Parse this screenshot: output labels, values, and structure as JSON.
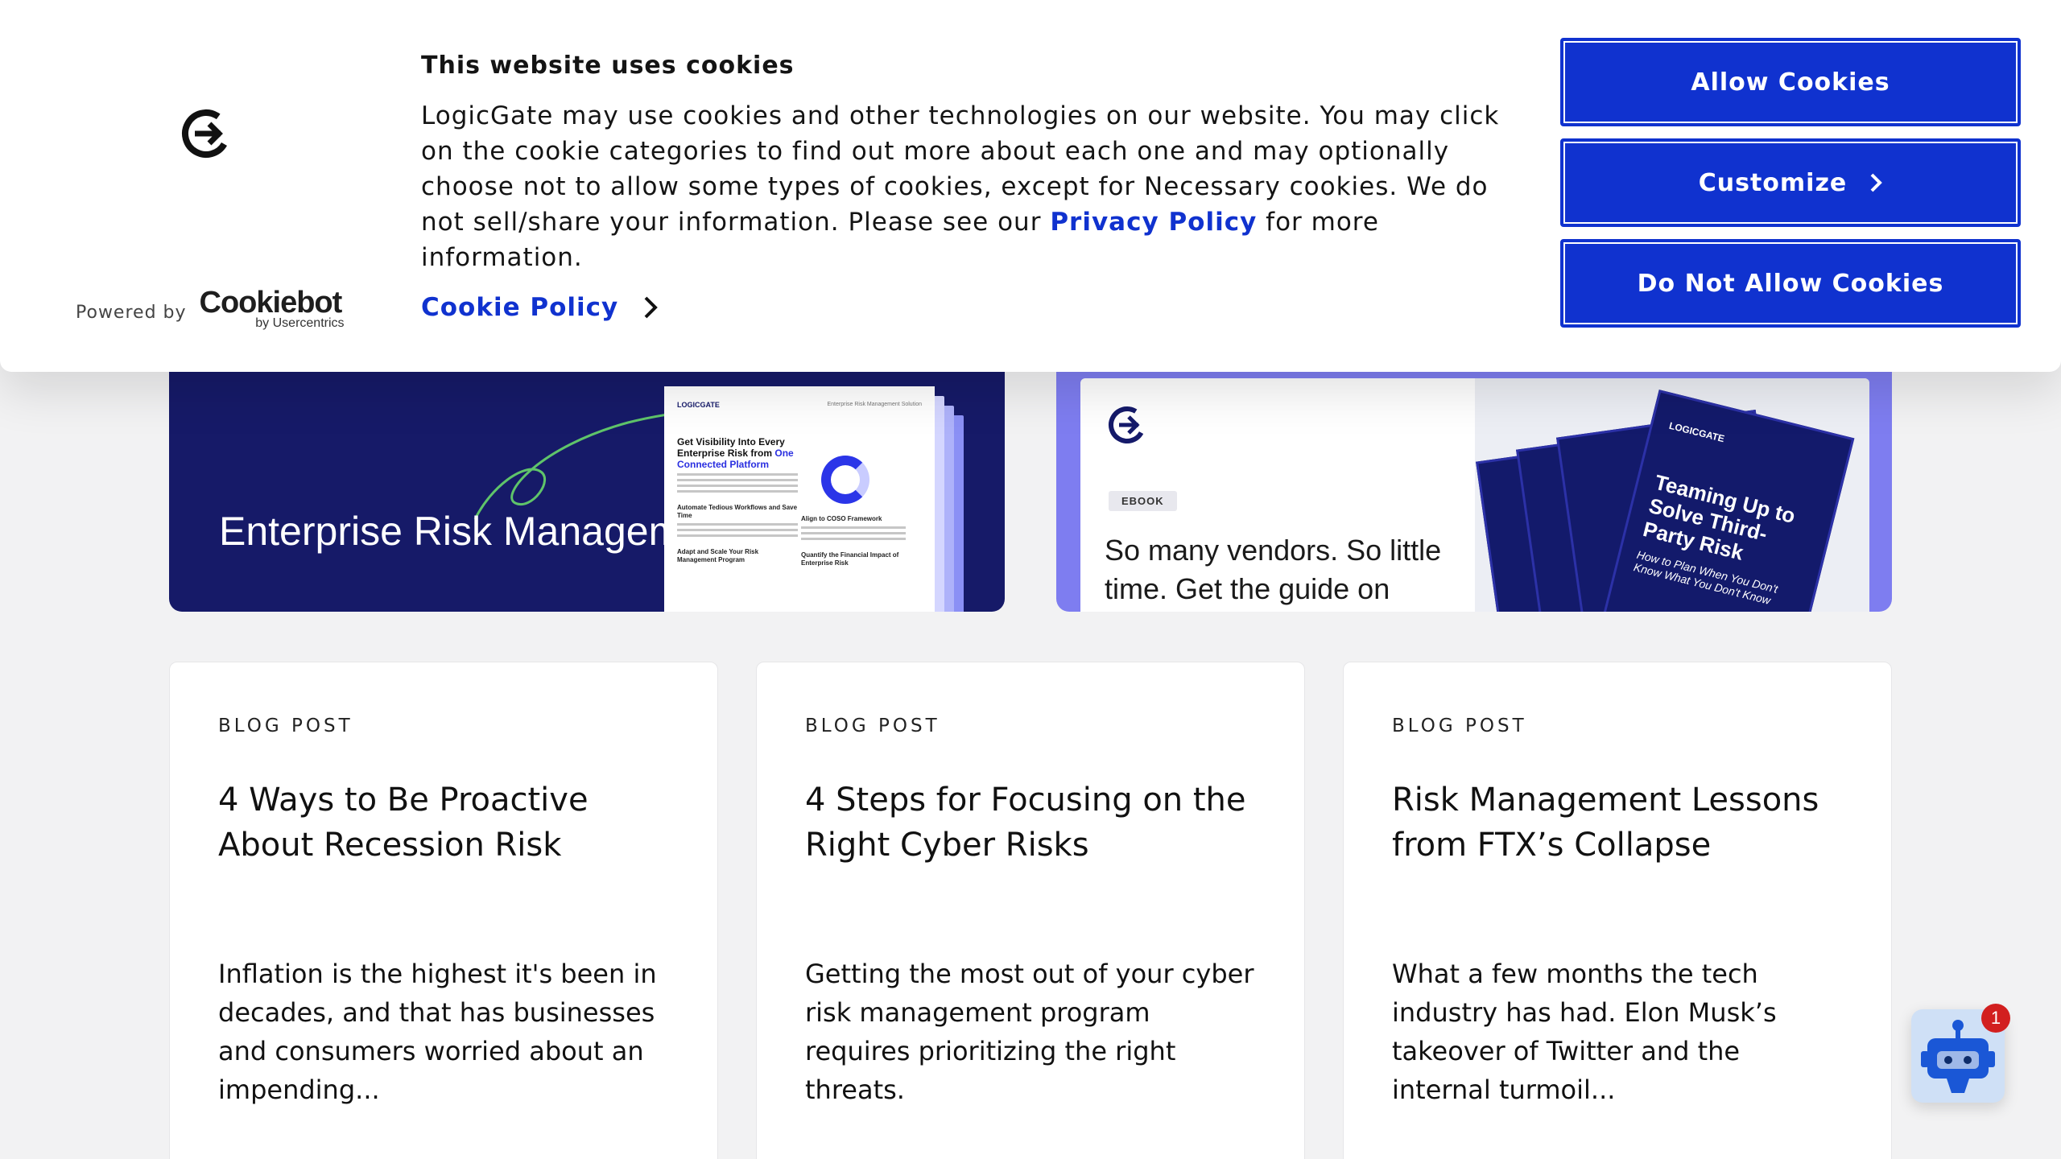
{
  "cookie_banner": {
    "heading": "This website uses cookies",
    "body_before_link": "LogicGate may use cookies and other technologies on our website. You may click on the cookie categories to find out more about each one and may optionally choose not to allow some types of cookies, except for Necessary cookies.  We do not sell/share your information. Please see our ",
    "privacy_link": "Privacy Policy",
    "body_after_link": " for more information.",
    "cookie_policy_link": "Cookie Policy",
    "powered_by": "Powered by",
    "brand_name": "Cookiebot",
    "brand_sub": "by Usercentrics",
    "buttons": {
      "allow": "Allow Cookies",
      "customize": "Customize",
      "deny": "Do Not Allow Cookies"
    },
    "accent_color": "#1032cf"
  },
  "promos": [
    {
      "title": "Enterprise Risk Management Solution",
      "doc": {
        "logo": "LOGICGATE",
        "label": "Enterprise Risk Management Solution",
        "headline": "Get Visibility Into Every Enterprise Risk from",
        "headline_accent": "One Connected Platform",
        "sections": [
          "Automate Tedious Workflows and Save Time",
          "Adapt and Scale Your Risk Management Program",
          "Align to COSO Framework",
          "Quantify the Financial Impact of Enterprise Risk"
        ]
      }
    },
    {
      "badge": "EBOOK",
      "text": "So many vendors. So little time. Get the guide on",
      "book_logo": "LOGICGATE",
      "book_title": "Teaming Up to Solve Third-Party Risk",
      "book_sub": "How to Plan When You Don't Know What You Don't Know"
    }
  ],
  "cards": [
    {
      "kicker": "BLOG POST",
      "title": "4 Ways to Be Proactive About Recession Risk",
      "excerpt": "Inflation is the highest it's been in decades, and that has businesses and consumers worried about an impending..."
    },
    {
      "kicker": "BLOG POST",
      "title": "4 Steps for Focusing on the Right Cyber Risks",
      "excerpt": "Getting the most out of your cyber risk management program requires prioritizing the right threats."
    },
    {
      "kicker": "BLOG POST",
      "title": "Risk Management Lessons from FTX’s Collapse",
      "excerpt": "What a few months the tech industry has had.  Elon Musk’s takeover of Twitter and the internal turmoil..."
    }
  ],
  "chatbot": {
    "icon": "robot-icon",
    "badge_count": "1"
  }
}
